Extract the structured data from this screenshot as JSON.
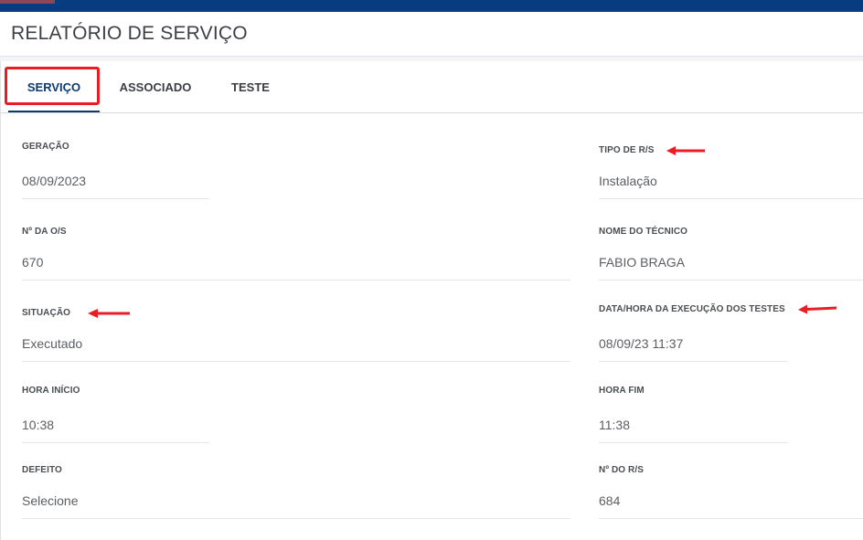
{
  "header": {
    "title": "RELATÓRIO DE SERVIÇO"
  },
  "tabs": [
    {
      "label": "SERVIÇO",
      "active": true
    },
    {
      "label": "ASSOCIADO",
      "active": false
    },
    {
      "label": "TESTE",
      "active": false
    }
  ],
  "fields": {
    "geracao": {
      "label": "GERAÇÃO",
      "value": "08/09/2023"
    },
    "tipo_rs": {
      "label": "TIPO DE R/S",
      "value": "Instalação"
    },
    "num_os": {
      "label": "Nº DA O/S",
      "value": "670"
    },
    "nome_tecnico": {
      "label": "NOME DO TÉCNICO",
      "value": "FABIO BRAGA"
    },
    "situacao": {
      "label": "SITUAÇÃO",
      "value": "Executado"
    },
    "data_hora_testes": {
      "label": "DATA/HORA DA EXECUÇÃO DOS TESTES",
      "value": "08/09/23 11:37"
    },
    "hora_inicio": {
      "label": "HORA INÍCIO",
      "value": "10:38"
    },
    "hora_fim": {
      "label": "HORA FIM",
      "value": "11:38"
    },
    "defeito": {
      "label": "DEFEITO",
      "value": "Selecione"
    },
    "num_rs": {
      "label": "Nº DO R/S",
      "value": "684"
    }
  },
  "colors": {
    "topbar": "#053d80",
    "accent": "#0b3a72",
    "annotation": "#ea1c24"
  },
  "annotations": [
    "red-arrow-icon",
    "red-highlight-box"
  ]
}
